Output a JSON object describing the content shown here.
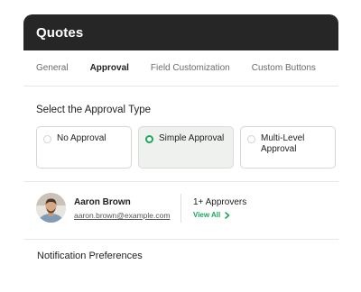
{
  "header": {
    "title": "Quotes"
  },
  "tabs": [
    {
      "label": "General",
      "active": false
    },
    {
      "label": "Approval",
      "active": true
    },
    {
      "label": "Field Customization",
      "active": false
    },
    {
      "label": "Custom Buttons",
      "active": false
    }
  ],
  "approval_type": {
    "heading": "Select the Approval Type",
    "options": [
      {
        "label": "No Approval",
        "selected": false
      },
      {
        "label": "Simple Approval",
        "selected": true
      },
      {
        "label": "Multi-Level Approval",
        "selected": false
      }
    ]
  },
  "approver": {
    "name": "Aaron Brown",
    "email": "aaron.brown@example.com",
    "count_label": "1+ Approvers",
    "view_all": "View All"
  },
  "notifications": {
    "heading": "Notification Preferences"
  },
  "colors": {
    "accent": "#1aa85a",
    "titlebar": "#262626"
  }
}
